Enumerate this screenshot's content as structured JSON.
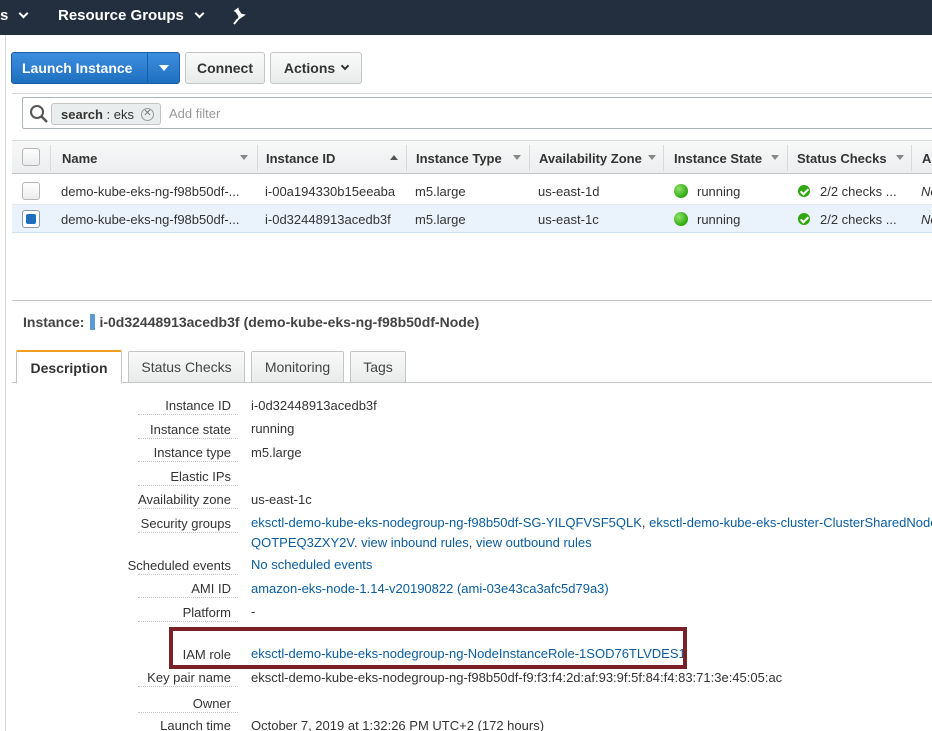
{
  "topnav": {
    "left_fragment": "s",
    "resource_groups": "Resource Groups"
  },
  "toolbar": {
    "launch_label": "Launch Instance",
    "connect_label": "Connect",
    "actions_label": "Actions"
  },
  "filter": {
    "token_key": "search",
    "token_sep": " : ",
    "token_value": "eks",
    "placeholder": "Add filter"
  },
  "table": {
    "columns": [
      "Name",
      "Instance ID",
      "Instance Type",
      "Availability Zone",
      "Instance State",
      "Status Checks",
      "A"
    ],
    "rows": [
      {
        "name": "demo-kube-eks-ng-f98b50df-...",
        "id": "i-00a194330b15eeaba",
        "type": "m5.large",
        "az": "us-east-1d",
        "state": "running",
        "checks": "2/2 checks ...",
        "extra": "No"
      },
      {
        "name": "demo-kube-eks-ng-f98b50df-...",
        "id": "i-0d32448913acedb3f",
        "type": "m5.large",
        "az": "us-east-1c",
        "state": "running",
        "checks": "2/2 checks ...",
        "extra": "No"
      }
    ]
  },
  "details": {
    "instance_prefix": "Instance:",
    "instance_id": "i-0d32448913acedb3f",
    "instance_name": "(demo-kube-eks-ng-f98b50df-Node)",
    "tabs": [
      "Description",
      "Status Checks",
      "Monitoring",
      "Tags"
    ],
    "fields": {
      "instance_id_label": "Instance ID",
      "instance_id": "i-0d32448913acedb3f",
      "state_label": "Instance state",
      "state": "running",
      "type_label": "Instance type",
      "type": "m5.large",
      "eip_label": "Elastic IPs",
      "az_label": "Availability zone",
      "az": "us-east-1c",
      "sg_label": "Security groups",
      "sg_link1": "eksctl-demo-kube-eks-nodegroup-ng-f98b50df-SG-YILQFVSF5QLK",
      "sg_sep": ",",
      "sg_link2": "eksctl-demo-kube-eks-cluster-ClusterSharedNode",
      "sg_link2_cont": "QOTPEQ3ZXY2V",
      "sg_period": ".",
      "inbound": "view inbound rules",
      "outbound": "view outbound rules",
      "sched_label": "Scheduled events",
      "sched": "No scheduled events",
      "ami_label": "AMI ID",
      "ami": "amazon-eks-node-1.14-v20190822 (ami-03e43ca3afc5d79a3)",
      "platform_label": "Platform",
      "platform": "-",
      "iam_label": "IAM role",
      "iam": "eksctl-demo-kube-eks-nodegroup-ng-NodeInstanceRole-1SOD76TLVDES1",
      "keypair_label": "Key pair name",
      "keypair": "eksctl-demo-kube-eks-nodegroup-ng-f98b50df-f9:f3:f4:2d:af:93:9f:5f:84:f4:83:71:3e:45:05:ac",
      "owner_label": "Owner",
      "launch_label": "Launch time",
      "launch": "October 7, 2019 at 1:32:26 PM UTC+2 (172 hours)"
    }
  },
  "colors": {
    "nav_bg": "#232f3e",
    "primary": "#1f6fbf",
    "link": "#0a5c9e",
    "tab_accent": "#f09d1d",
    "running": "#2ea80e",
    "highlight_box": "#7a2027"
  }
}
